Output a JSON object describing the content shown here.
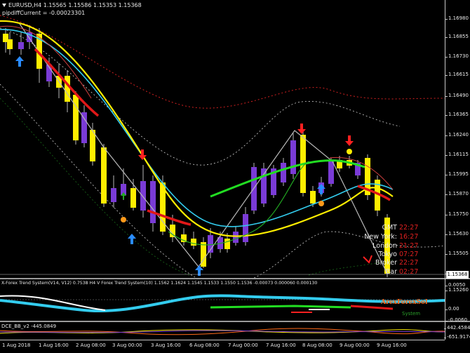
{
  "header": {
    "symbol_line": "EURUSD,H4  1.15565 1.15586 1.15353 1.15368",
    "pipdiff_line": "pipdiffCurrent = -0.00023301"
  },
  "price_axis": {
    "ticks": [
      "1.16980",
      "1.16855",
      "1.16730",
      "1.16615",
      "1.16490",
      "1.16365",
      "1.16240",
      "1.16115",
      "1.15995",
      "1.15870",
      "1.15750",
      "1.15630",
      "1.15505",
      "1.15385",
      "1.15260"
    ],
    "current_price": "1.15368"
  },
  "time_axis": {
    "labels": [
      "1 Aug 2018",
      "1 Aug 16:00",
      "2 Aug 08:00",
      "3 Aug 00:00",
      "3 Aug 16:00",
      "6 Aug 08:00",
      "7 Aug 00:00",
      "7 Aug 16:00",
      "8 Aug 08:00",
      "9 Aug 00:00",
      "9 Aug 16:00"
    ]
  },
  "session_clocks": [
    {
      "name": "GMT",
      "time": "22:27"
    },
    {
      "name": "New York:",
      "time": "16:27"
    },
    {
      "name": "London",
      "time": "21:27"
    },
    {
      "name": "Tokyo",
      "time": "07:27"
    },
    {
      "name": "Broker",
      "time": "22:27"
    },
    {
      "name": "Bar",
      "time": "02:27"
    }
  ],
  "indicator1": {
    "title": "X-Forex Trend System(V14, V12) 0.7538 H4 V Forex Trend System(10) 1.1562 1.1624 1.1545 1.1533 1.1550 1.1536 -0.00073 0.000060 0.000130",
    "ticks": [
      "0.0050",
      "0.00",
      "-0.0060"
    ],
    "brand": "ArexForexSol",
    "brand_sub": "System"
  },
  "indicator2": {
    "title": "DCE_BB_v2 -445.0849",
    "ticks": [
      "442.4584",
      "-651.9174"
    ]
  },
  "colors": {
    "bull_candle": "#7a3bd6",
    "bear_candle": "#ffee00",
    "ema_fast": "#ffee00",
    "ema_mid": "#22dd22",
    "ema_slow": "#33ccee",
    "trend_red": "#e01818",
    "zigzag": "#b8b8b8",
    "buy_arrow": "#2a8cff",
    "sell_arrow": "#ff2020"
  }
}
